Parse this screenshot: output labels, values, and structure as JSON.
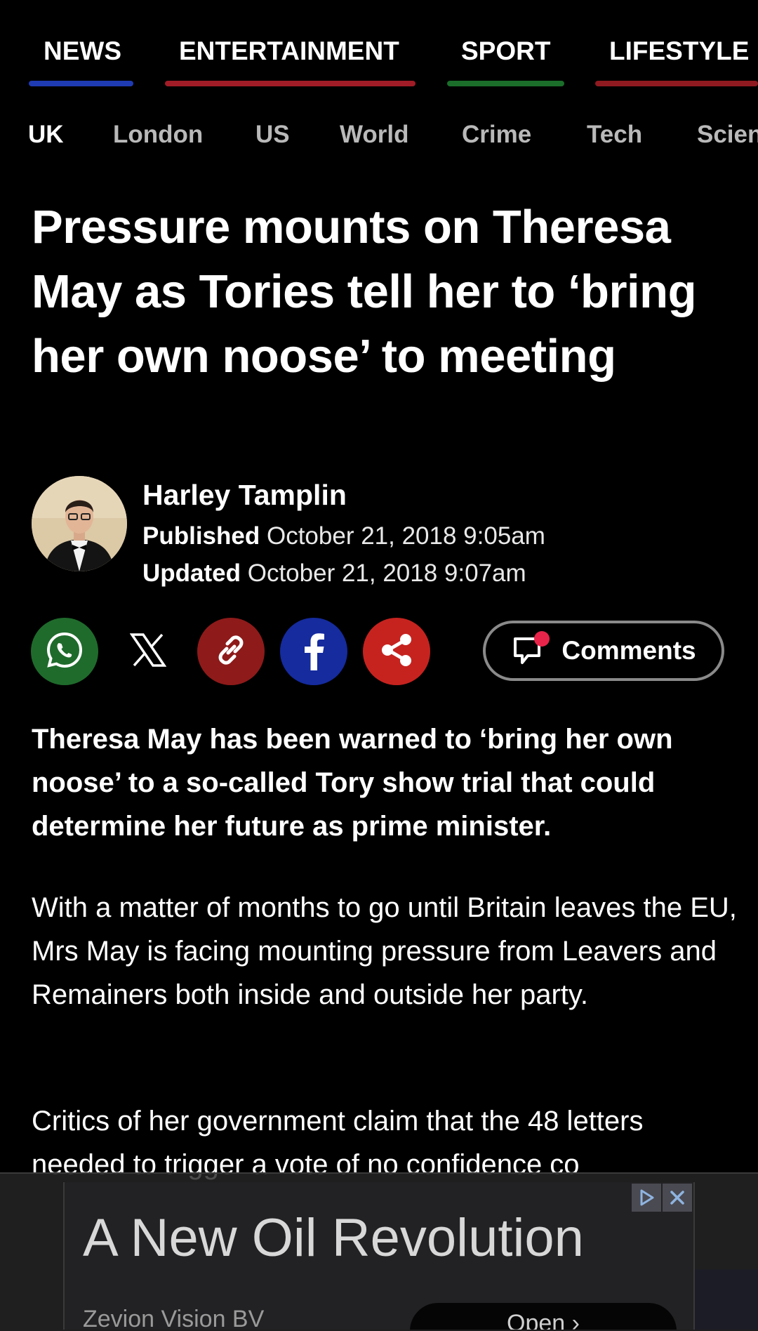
{
  "section_nav": {
    "items": [
      {
        "label": "NEWS",
        "color": "#1f3bb3"
      },
      {
        "label": "ENTERTAINMENT",
        "color": "#a01c26"
      },
      {
        "label": "SPORT",
        "color": "#1a6e2a"
      },
      {
        "label": "LIFESTYLE",
        "color": "#8f1a20"
      }
    ]
  },
  "sub_nav": {
    "items": [
      "UK",
      "London",
      "US",
      "World",
      "Crime",
      "Tech",
      "Scien"
    ]
  },
  "article": {
    "headline": "Pressure mounts on Theresa May as Tories tell her to ‘bring her own noose’ to meeting",
    "author": "Harley Tamplin",
    "published_label": "Published",
    "published_date": "October 21, 2018 9:05am",
    "updated_label": "Updated",
    "updated_date": "October 21, 2018 9:07am",
    "lede": "Theresa May has been warned to ‘bring her own noose’ to a so-called Tory show trial that could determine her future as prime minister.",
    "paragraphs": [
      "With a matter of months to go until Britain leaves the EU, Mrs May is facing mounting pressure from Leavers and Remainers both inside and outside her party.",
      "Critics of her government claim that the 48 letters needed to trigger a vote of no confidence co"
    ]
  },
  "share": {
    "buttons": [
      {
        "icon": "whatsapp-icon",
        "color": "#1f6b2c"
      },
      {
        "icon": "x-icon",
        "color": "#000000"
      },
      {
        "icon": "link-icon",
        "color": "#8e1a1a"
      },
      {
        "icon": "facebook-icon",
        "color": "#152b9e"
      },
      {
        "icon": "share-icon",
        "color": "#c6231f"
      }
    ],
    "comments_label": "Comments"
  },
  "ad": {
    "title": "A New Oil Revolution",
    "sponsor": "Zevion Vision BV",
    "cta": "Open  ›"
  }
}
